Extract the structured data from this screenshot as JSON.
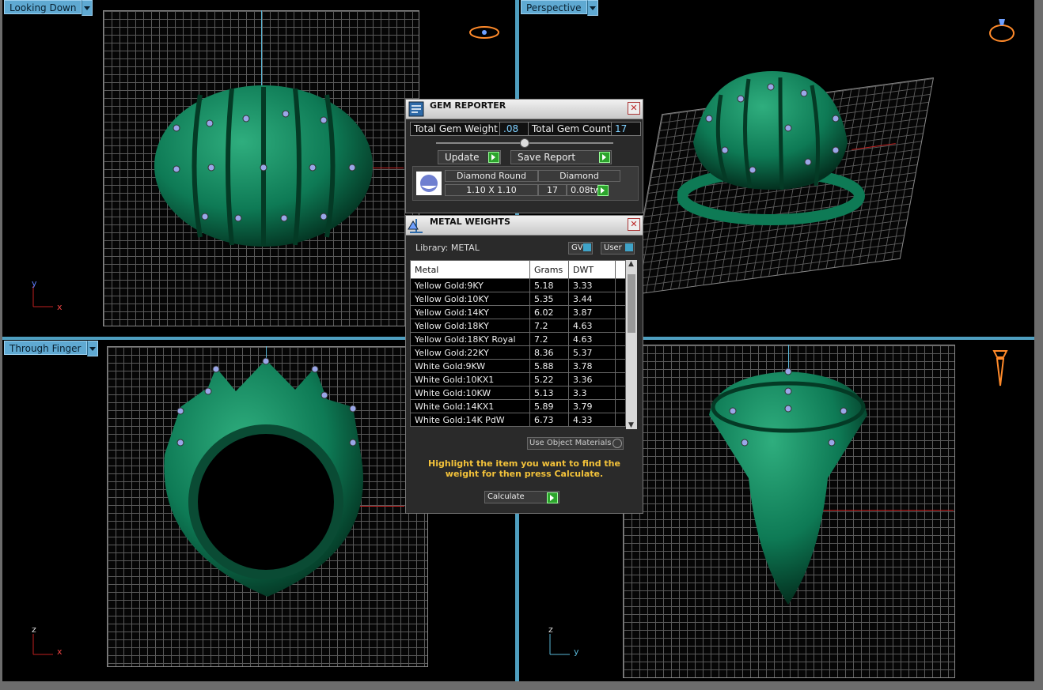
{
  "viewports": {
    "top_left": {
      "label": "Looking Down",
      "axis_vertical": "y",
      "axis_horizontal": "x"
    },
    "top_right": {
      "label": "Perspective"
    },
    "bottom_left": {
      "label": "Through Finger",
      "axis_vertical": "z",
      "axis_horizontal": "x"
    },
    "bottom_right": {
      "axis_vertical": "z",
      "axis_horizontal": "y"
    }
  },
  "gem_reporter": {
    "title": "GEM REPORTER",
    "close": "✕",
    "total_weight_label": "Total Gem Weight",
    "total_weight_value": ".08",
    "total_count_label": "Total Gem Count",
    "total_count_value": "17",
    "update_label": "Update",
    "save_label": "Save Report",
    "gem": {
      "shape": "Diamond Round",
      "type": "Diamond",
      "size": "1.10 X 1.10",
      "count": "17",
      "weight": "0.08tw"
    }
  },
  "metal_weights": {
    "title": "METAL WEIGHTS",
    "close": "✕",
    "library_label": "Library: METAL",
    "gv_label": "GV",
    "user_label": "User",
    "columns": [
      "Metal",
      "Grams",
      "DWT"
    ],
    "rows": [
      [
        "Yellow Gold:9KY",
        "5.18",
        "3.33"
      ],
      [
        "Yellow Gold:10KY",
        "5.35",
        "3.44"
      ],
      [
        "Yellow Gold:14KY",
        "6.02",
        "3.87"
      ],
      [
        "Yellow Gold:18KY",
        "7.2",
        "4.63"
      ],
      [
        "Yellow Gold:18KY Royal",
        "7.2",
        "4.63"
      ],
      [
        "Yellow Gold:22KY",
        "8.36",
        "5.37"
      ],
      [
        "White Gold:9KW",
        "5.88",
        "3.78"
      ],
      [
        "White Gold:10KX1",
        "5.22",
        "3.36"
      ],
      [
        "White Gold:10KW",
        "5.13",
        "3.3"
      ],
      [
        "White Gold:14KX1",
        "5.89",
        "3.79"
      ],
      [
        "White Gold:14K PdW",
        "6.73",
        "4.33"
      ]
    ],
    "use_object_materials": "Use Object Materials",
    "hint": "Highlight the item you want to find the weight for then press Calculate.",
    "calculate_label": "Calculate"
  },
  "colors": {
    "ring_green": "#0e7a55",
    "viewport_label": "#5fa9d2",
    "hint_text": "#f3c23a",
    "go_button": "#2ca42c"
  }
}
